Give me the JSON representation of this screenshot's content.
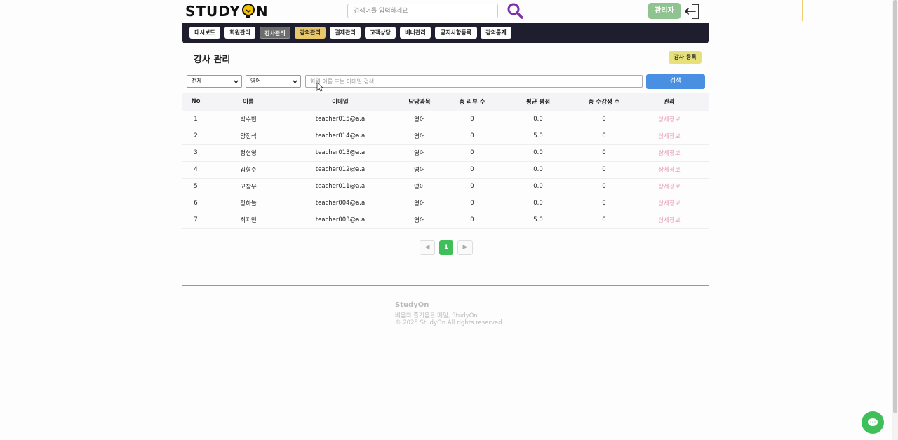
{
  "header": {
    "logo_left": "STUDY",
    "logo_right": "N",
    "search_placeholder": "검색어를 입력하세요",
    "admin_label": "관리자"
  },
  "nav": {
    "items": [
      {
        "label": "대시보드"
      },
      {
        "label": "회원관리"
      },
      {
        "label": "강사관리"
      },
      {
        "label": "강의관리"
      },
      {
        "label": "결제관리"
      },
      {
        "label": "고객상담"
      },
      {
        "label": "배너관리"
      },
      {
        "label": "공지사항등록"
      },
      {
        "label": "강의통계"
      }
    ],
    "active": "강사관리"
  },
  "page": {
    "title": "강사 관리",
    "register_label": "강사 등록"
  },
  "filters": {
    "scope_value": "전체",
    "subject_value": "영어",
    "keyword_placeholder": "회원 이름 또는 이메일 검색...",
    "search_label": "검색"
  },
  "table": {
    "headers": [
      "No",
      "이름",
      "이메일",
      "담당과목",
      "총 리뷰 수",
      "평균 평점",
      "총 수강생 수",
      "관리"
    ],
    "rows": [
      {
        "no": "1",
        "name": "박수빈",
        "email": "teacher015@a.a",
        "subject": "영어",
        "reviews": "0",
        "rating": "0.0",
        "students": "0",
        "action": "상세정보"
      },
      {
        "no": "2",
        "name": "양진석",
        "email": "teacher014@a.a",
        "subject": "영어",
        "reviews": "0",
        "rating": "5.0",
        "students": "0",
        "action": "상세정보"
      },
      {
        "no": "3",
        "name": "정현영",
        "email": "teacher013@a.a",
        "subject": "영어",
        "reviews": "0",
        "rating": "0.0",
        "students": "0",
        "action": "상세정보"
      },
      {
        "no": "4",
        "name": "김형수",
        "email": "teacher012@a.a",
        "subject": "영어",
        "reviews": "0",
        "rating": "0.0",
        "students": "0",
        "action": "상세정보"
      },
      {
        "no": "5",
        "name": "고창우",
        "email": "teacher011@a.a",
        "subject": "영어",
        "reviews": "0",
        "rating": "0.0",
        "students": "0",
        "action": "상세정보"
      },
      {
        "no": "6",
        "name": "정하늘",
        "email": "teacher004@a.a",
        "subject": "영어",
        "reviews": "0",
        "rating": "0.0",
        "students": "0",
        "action": "상세정보"
      },
      {
        "no": "7",
        "name": "최지민",
        "email": "teacher003@a.a",
        "subject": "영어",
        "reviews": "0",
        "rating": "5.0",
        "students": "0",
        "action": "상세정보"
      }
    ]
  },
  "pagination": {
    "prev": "◀",
    "current": "1",
    "next": "▶"
  },
  "footer": {
    "brand": "StudyOn",
    "tagline": "배움의 즐거움을 매일, StudyOn",
    "copyright": "© 2025 StudyOn All rights reserved."
  },
  "colors": {
    "nav_bg": "#1f1e2e",
    "admin_btn": "#8fc38f",
    "register_btn": "#e8e07a",
    "search_btn": "#4a90e2",
    "page_current": "#3fbf5a",
    "detail_link": "#e8a0b4",
    "search_icon": "#7b2fa8"
  }
}
